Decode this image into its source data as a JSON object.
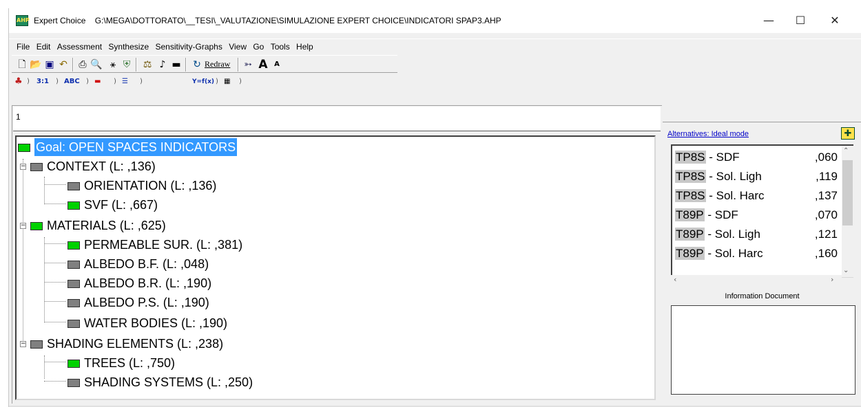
{
  "window": {
    "app_name": "Expert Choice",
    "file_path": "G:\\MEGA\\DOTTORATO\\__TESI\\_VALUTAZIONE\\SIMULAZIONE EXPERT CHOICE\\INDICATORI SPAP3.AHP",
    "icon_text": "AHP",
    "controls": {
      "minimize": "—",
      "maximize": "☐",
      "close": "✕"
    }
  },
  "menu": {
    "items": [
      "File",
      "Edit",
      "Assessment",
      "Synthesize",
      "Sensitivity-Graphs",
      "View",
      "Go",
      "Tools",
      "Help"
    ]
  },
  "toolbar": {
    "redraw_label": "Redraw",
    "icons": [
      "new-file-icon",
      "open-folder-icon",
      "save-icon",
      "undo-icon",
      "print-icon",
      "print-preview-icon",
      "hierarchy-icon",
      "shield-icon",
      "scales-icon",
      "music-note-icon",
      "screen-icon",
      "redraw-icon",
      "pointer-icon",
      "font-larger-icon",
      "font-smaller-icon"
    ]
  },
  "mode_tabs": {
    "ratio_label": "3:1",
    "abc_label": "ABC",
    "formula_label": "Y=f(x)"
  },
  "node_number": "1",
  "tree": {
    "goal": "Goal: OPEN SPACES INDICATORS",
    "nodes": [
      {
        "label": "CONTEXT (L: ,136)",
        "color": "gray"
      },
      {
        "label": "ORIENTATION (L: ,136)",
        "color": "gray"
      },
      {
        "label": "SVF (L: ,667)",
        "color": "green"
      },
      {
        "label": "MATERIALS (L: ,625)",
        "color": "green"
      },
      {
        "label": "PERMEABLE SUR. (L: ,381)",
        "color": "green"
      },
      {
        "label": "ALBEDO B.F. (L: ,048)",
        "color": "gray"
      },
      {
        "label": "ALBEDO B.R. (L: ,190)",
        "color": "gray"
      },
      {
        "label": "ALBEDO P.S. (L: ,190)",
        "color": "gray"
      },
      {
        "label": "WATER BODIES (L: ,190)",
        "color": "gray"
      },
      {
        "label": "SHADING ELEMENTS (L: ,238)",
        "color": "gray"
      },
      {
        "label": "TREES (L: ,750)",
        "color": "green"
      },
      {
        "label": "SHADING SYSTEMS (L: ,250)",
        "color": "gray"
      }
    ]
  },
  "alternatives": {
    "header": "Alternatives: Ideal mode",
    "items": [
      {
        "code": "TP8S",
        "name": " - SDF",
        "value": ",060"
      },
      {
        "code": "TP8S",
        "name": " - Sol. Ligh",
        "value": ",119"
      },
      {
        "code": "TP8S",
        "name": " - Sol. Harc",
        "value": ",137"
      },
      {
        "code": "T89P",
        "name": " - SDF",
        "value": ",070"
      },
      {
        "code": "T89P",
        "name": " - Sol. Ligh",
        "value": ",121"
      },
      {
        "code": "T89P",
        "name": " - Sol. Harc",
        "value": ",160"
      }
    ],
    "info_label": "Information Document"
  },
  "colors": {
    "node_green": "#00d200",
    "node_gray": "#808080",
    "selection_blue": "#3399ff",
    "link_blue": "#0000c8"
  }
}
